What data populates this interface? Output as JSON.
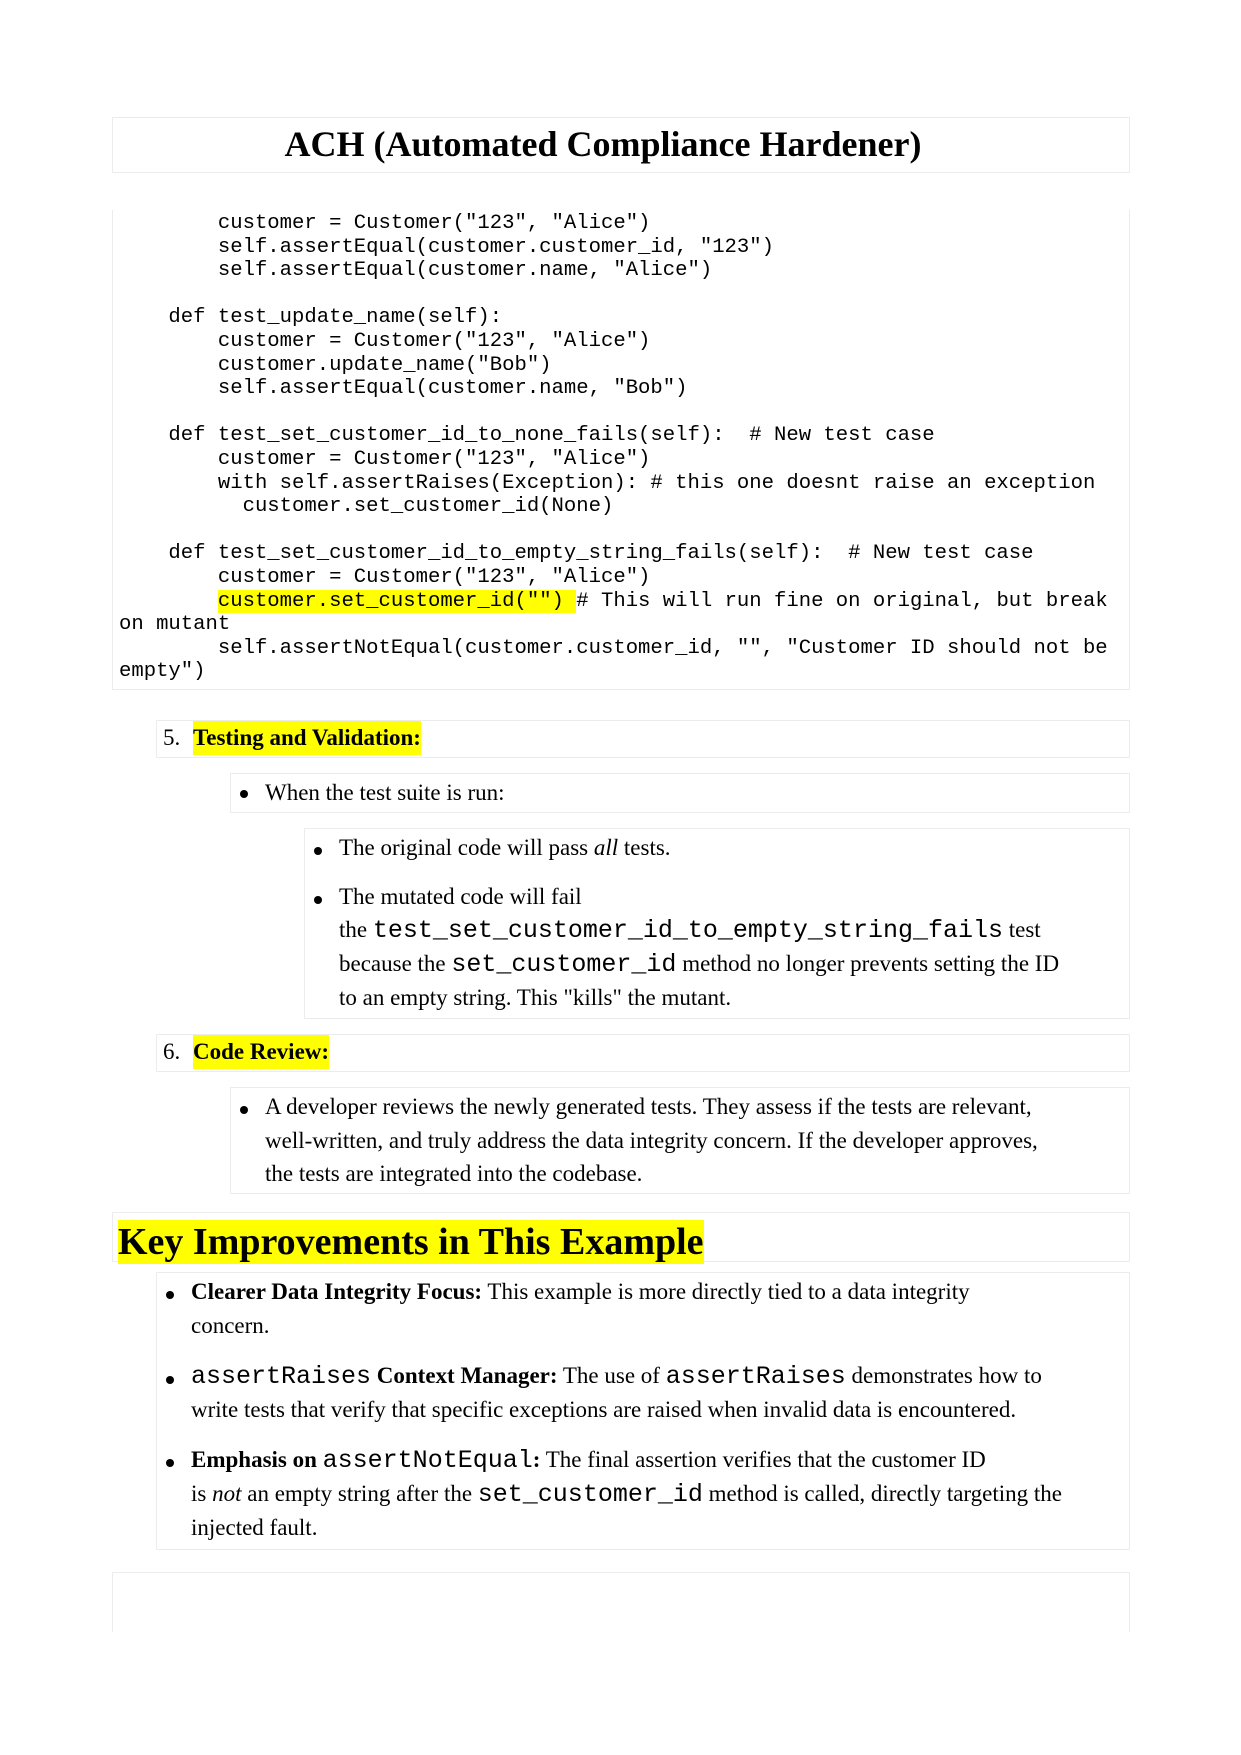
{
  "title": "ACH (Automated Compliance Hardener)",
  "code": {
    "before": "        customer = Customer(\"123\", \"Alice\")\n        self.assertEqual(customer.customer_id, \"123\")\n        self.assertEqual(customer.name, \"Alice\")\n\n    def test_update_name(self):\n        customer = Customer(\"123\", \"Alice\")\n        customer.update_name(\"Bob\")\n        self.assertEqual(customer.name, \"Bob\")\n\n    def test_set_customer_id_to_none_fails(self):  # New test case\n        customer = Customer(\"123\", \"Alice\")\n        with self.assertRaises(Exception): # this one doesnt raise an exception\n          customer.set_customer_id(None)\n\n    def test_set_customer_id_to_empty_string_fails(self):  # New test case\n        customer = Customer(\"123\", \"Alice\")\n        ",
    "highlight": "customer.set_customer_id(\"\") ",
    "after": "# This will run fine on original, but break\non mutant\n        self.assertNotEqual(customer.customer_id, \"\", \"Customer ID should not be\nempty\")"
  },
  "step5": {
    "number": "5.",
    "heading": "Testing and Validation:",
    "bullet": "When the test suite is run:",
    "sub1_a": "The original code will pass ",
    "sub1_em": "all",
    "sub1_b": " tests.",
    "sub2_line1": "The mutated code will fail",
    "sub2_the": "the ",
    "sub2_code1": "test_set_customer_id_to_empty_string_fails",
    "sub2_test": " test",
    "sub2_because": "because the ",
    "sub2_code2": "set_customer_id",
    "sub2_rest": " method no longer prevents setting the ID",
    "sub2_line4": "to an empty string. This \"kills\" the mutant."
  },
  "step6": {
    "number": "6.",
    "heading": "Code Review:",
    "line1": "A developer reviews the newly generated tests. They assess if the tests are relevant,",
    "line2": "well-written, and truly address the data integrity concern. If the developer approves,",
    "line3": "the tests are integrated into the codebase."
  },
  "key": {
    "heading": "Key Improvements in This Example",
    "item1_bold": "Clearer Data Integrity Focus:",
    "item1_text": " This example is more directly tied to a data integrity",
    "item1_line2": "concern.",
    "item2_code": "assertRaises",
    "item2_bold": " Context Manager:",
    "item2_text": " The use of ",
    "item2_code2": "assertRaises",
    "item2_text2": " demonstrates how to",
    "item2_line2": "write tests that verify that specific exceptions are raised when invalid data is encountered.",
    "item3_bold": "Emphasis on ",
    "item3_code": "assertNotEqual",
    "item3_bold2": ":",
    "item3_text": " The final assertion verifies that the customer ID",
    "item3_is": "is ",
    "item3_em": "not",
    "item3_text2": " an empty string after the ",
    "item3_code2": "set_customer_id",
    "item3_text3": " method is called, directly targeting the",
    "item3_line3": "injected fault."
  }
}
